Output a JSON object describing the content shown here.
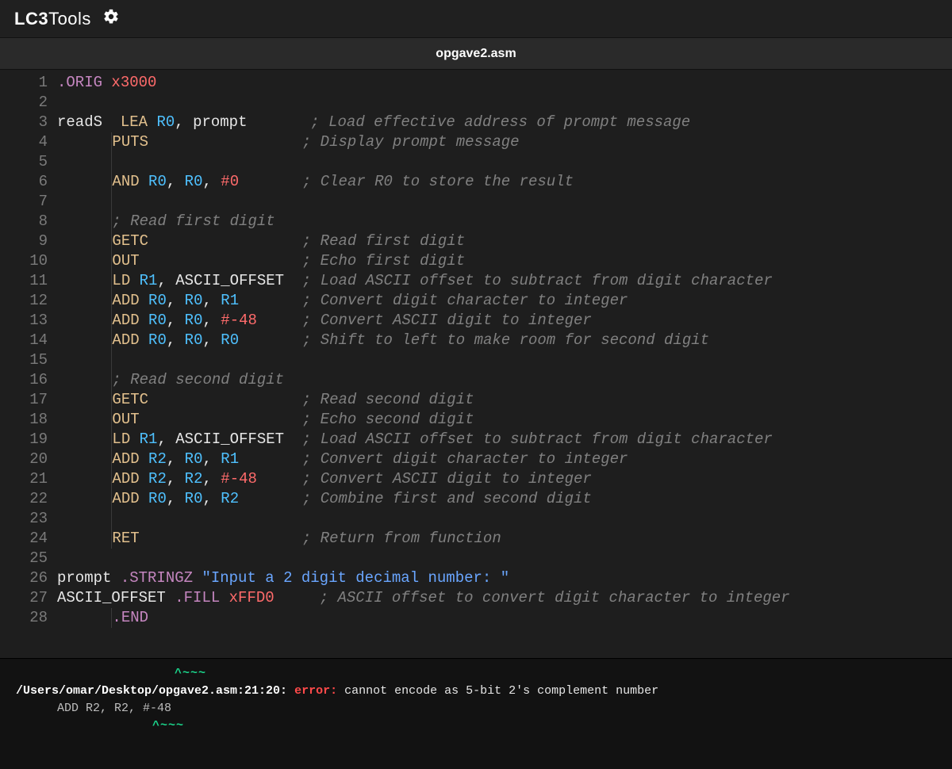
{
  "app": {
    "title_bold": "LC3",
    "title_thin": "Tools"
  },
  "tab": {
    "filename": "opgave2.asm"
  },
  "editor": {
    "lines": [
      {
        "n": 1,
        "tokens": [
          {
            "t": ".ORIG",
            "c": "tok-dir"
          },
          {
            "t": " "
          },
          {
            "t": "x3000",
            "c": "tok-num"
          }
        ]
      },
      {
        "n": 2,
        "tokens": []
      },
      {
        "n": 3,
        "tokens": [
          {
            "t": "readS",
            "c": "tok-lbl"
          },
          {
            "t": "  "
          },
          {
            "t": "LEA",
            "c": "tok-kw"
          },
          {
            "t": " "
          },
          {
            "t": "R0",
            "c": "tok-reg"
          },
          {
            "t": ", ",
            "c": "tok-punc"
          },
          {
            "t": "prompt",
            "c": "tok-lbl"
          },
          {
            "t": "       "
          },
          {
            "t": "; Load effective address of prompt message",
            "c": "tok-com"
          }
        ]
      },
      {
        "n": 4,
        "guide": true,
        "tokens": [
          {
            "t": "       "
          },
          {
            "t": "PUTS",
            "c": "tok-kw"
          },
          {
            "t": "                 "
          },
          {
            "t": "; Display prompt message",
            "c": "tok-com"
          }
        ]
      },
      {
        "n": 5,
        "guide": true,
        "tokens": []
      },
      {
        "n": 6,
        "guide": true,
        "tokens": [
          {
            "t": "       "
          },
          {
            "t": "AND",
            "c": "tok-kw"
          },
          {
            "t": " "
          },
          {
            "t": "R0",
            "c": "tok-reg"
          },
          {
            "t": ", ",
            "c": "tok-punc"
          },
          {
            "t": "R0",
            "c": "tok-reg"
          },
          {
            "t": ", ",
            "c": "tok-punc"
          },
          {
            "t": "#0",
            "c": "tok-num"
          },
          {
            "t": "       "
          },
          {
            "t": "; Clear R0 to store the result",
            "c": "tok-com"
          }
        ]
      },
      {
        "n": 7,
        "guide": true,
        "tokens": []
      },
      {
        "n": 8,
        "guide": true,
        "tokens": [
          {
            "t": "       "
          },
          {
            "t": "; Read first digit",
            "c": "tok-com"
          }
        ]
      },
      {
        "n": 9,
        "guide": true,
        "tokens": [
          {
            "t": "       "
          },
          {
            "t": "GETC",
            "c": "tok-kw"
          },
          {
            "t": "                 "
          },
          {
            "t": "; Read first digit",
            "c": "tok-com"
          }
        ]
      },
      {
        "n": 10,
        "guide": true,
        "tokens": [
          {
            "t": "       "
          },
          {
            "t": "OUT",
            "c": "tok-kw"
          },
          {
            "t": "                  "
          },
          {
            "t": "; Echo first digit",
            "c": "tok-com"
          }
        ]
      },
      {
        "n": 11,
        "guide": true,
        "tokens": [
          {
            "t": "       "
          },
          {
            "t": "LD",
            "c": "tok-kw"
          },
          {
            "t": " "
          },
          {
            "t": "R1",
            "c": "tok-reg"
          },
          {
            "t": ", ",
            "c": "tok-punc"
          },
          {
            "t": "ASCII_OFFSET",
            "c": "tok-lbl"
          },
          {
            "t": "  "
          },
          {
            "t": "; Load ASCII offset to subtract from digit character",
            "c": "tok-com"
          }
        ]
      },
      {
        "n": 12,
        "guide": true,
        "tokens": [
          {
            "t": "       "
          },
          {
            "t": "ADD",
            "c": "tok-kw"
          },
          {
            "t": " "
          },
          {
            "t": "R0",
            "c": "tok-reg"
          },
          {
            "t": ", ",
            "c": "tok-punc"
          },
          {
            "t": "R0",
            "c": "tok-reg"
          },
          {
            "t": ", ",
            "c": "tok-punc"
          },
          {
            "t": "R1",
            "c": "tok-reg"
          },
          {
            "t": "       "
          },
          {
            "t": "; Convert digit character to integer",
            "c": "tok-com"
          }
        ]
      },
      {
        "n": 13,
        "guide": true,
        "tokens": [
          {
            "t": "       "
          },
          {
            "t": "ADD",
            "c": "tok-kw"
          },
          {
            "t": " "
          },
          {
            "t": "R0",
            "c": "tok-reg"
          },
          {
            "t": ", ",
            "c": "tok-punc"
          },
          {
            "t": "R0",
            "c": "tok-reg"
          },
          {
            "t": ", ",
            "c": "tok-punc"
          },
          {
            "t": "#-48",
            "c": "tok-num"
          },
          {
            "t": "     "
          },
          {
            "t": "; Convert ASCII digit to integer",
            "c": "tok-com"
          }
        ]
      },
      {
        "n": 14,
        "guide": true,
        "tokens": [
          {
            "t": "       "
          },
          {
            "t": "ADD",
            "c": "tok-kw"
          },
          {
            "t": " "
          },
          {
            "t": "R0",
            "c": "tok-reg"
          },
          {
            "t": ", ",
            "c": "tok-punc"
          },
          {
            "t": "R0",
            "c": "tok-reg"
          },
          {
            "t": ", ",
            "c": "tok-punc"
          },
          {
            "t": "R0",
            "c": "tok-reg"
          },
          {
            "t": "       "
          },
          {
            "t": "; Shift to left to make room for second digit",
            "c": "tok-com"
          }
        ]
      },
      {
        "n": 15,
        "guide": true,
        "tokens": []
      },
      {
        "n": 16,
        "guide": true,
        "tokens": [
          {
            "t": "       "
          },
          {
            "t": "; Read second digit",
            "c": "tok-com"
          }
        ]
      },
      {
        "n": 17,
        "guide": true,
        "tokens": [
          {
            "t": "       "
          },
          {
            "t": "GETC",
            "c": "tok-kw"
          },
          {
            "t": "                 "
          },
          {
            "t": "; Read second digit",
            "c": "tok-com"
          }
        ]
      },
      {
        "n": 18,
        "guide": true,
        "tokens": [
          {
            "t": "       "
          },
          {
            "t": "OUT",
            "c": "tok-kw"
          },
          {
            "t": "                  "
          },
          {
            "t": "; Echo second digit",
            "c": "tok-com"
          }
        ]
      },
      {
        "n": 19,
        "guide": true,
        "tokens": [
          {
            "t": "       "
          },
          {
            "t": "LD",
            "c": "tok-kw"
          },
          {
            "t": " "
          },
          {
            "t": "R1",
            "c": "tok-reg"
          },
          {
            "t": ", ",
            "c": "tok-punc"
          },
          {
            "t": "ASCII_OFFSET",
            "c": "tok-lbl"
          },
          {
            "t": "  "
          },
          {
            "t": "; Load ASCII offset to subtract from digit character",
            "c": "tok-com"
          }
        ]
      },
      {
        "n": 20,
        "guide": true,
        "tokens": [
          {
            "t": "       "
          },
          {
            "t": "ADD",
            "c": "tok-kw"
          },
          {
            "t": " "
          },
          {
            "t": "R2",
            "c": "tok-reg"
          },
          {
            "t": ", ",
            "c": "tok-punc"
          },
          {
            "t": "R0",
            "c": "tok-reg"
          },
          {
            "t": ", ",
            "c": "tok-punc"
          },
          {
            "t": "R1",
            "c": "tok-reg"
          },
          {
            "t": "       "
          },
          {
            "t": "; Convert digit character to integer",
            "c": "tok-com"
          }
        ]
      },
      {
        "n": 21,
        "guide": true,
        "tokens": [
          {
            "t": "       "
          },
          {
            "t": "ADD",
            "c": "tok-kw"
          },
          {
            "t": " "
          },
          {
            "t": "R2",
            "c": "tok-reg"
          },
          {
            "t": ", ",
            "c": "tok-punc"
          },
          {
            "t": "R2",
            "c": "tok-reg"
          },
          {
            "t": ", ",
            "c": "tok-punc"
          },
          {
            "t": "#-48",
            "c": "tok-num"
          },
          {
            "t": "     "
          },
          {
            "t": "; Convert ASCII digit to integer",
            "c": "tok-com"
          }
        ]
      },
      {
        "n": 22,
        "guide": true,
        "tokens": [
          {
            "t": "       "
          },
          {
            "t": "ADD",
            "c": "tok-kw"
          },
          {
            "t": " "
          },
          {
            "t": "R0",
            "c": "tok-reg"
          },
          {
            "t": ", ",
            "c": "tok-punc"
          },
          {
            "t": "R0",
            "c": "tok-reg"
          },
          {
            "t": ", ",
            "c": "tok-punc"
          },
          {
            "t": "R2",
            "c": "tok-reg"
          },
          {
            "t": "       "
          },
          {
            "t": "; Combine first and second digit",
            "c": "tok-com"
          }
        ]
      },
      {
        "n": 23,
        "guide": true,
        "tokens": []
      },
      {
        "n": 24,
        "guide": true,
        "tokens": [
          {
            "t": "       "
          },
          {
            "t": "RET",
            "c": "tok-kw"
          },
          {
            "t": "                  "
          },
          {
            "t": "; Return from function",
            "c": "tok-com"
          }
        ]
      },
      {
        "n": 25,
        "tokens": []
      },
      {
        "n": 26,
        "tokens": [
          {
            "t": "prompt",
            "c": "tok-lbl"
          },
          {
            "t": " "
          },
          {
            "t": ".STRINGZ",
            "c": "tok-dir"
          },
          {
            "t": " "
          },
          {
            "t": "\"Input a 2 digit decimal number: \"",
            "c": "tok-str"
          }
        ]
      },
      {
        "n": 27,
        "tokens": [
          {
            "t": "ASCII_OFFSET",
            "c": "tok-lbl"
          },
          {
            "t": " "
          },
          {
            "t": ".FILL",
            "c": "tok-dir"
          },
          {
            "t": " "
          },
          {
            "t": "xFFD0",
            "c": "tok-num"
          },
          {
            "t": "     "
          },
          {
            "t": "; ASCII offset to convert digit character to integer",
            "c": "tok-com"
          }
        ]
      },
      {
        "n": 28,
        "guide": true,
        "tokens": [
          {
            "t": ".END",
            "c": "tok-dir"
          }
        ]
      }
    ]
  },
  "console": {
    "top_wave": "^~~~",
    "path": "/Users/omar/Desktop/opgave2.asm:21:20:",
    "error_label": "error:",
    "message": "cannot encode as 5-bit 2's complement number",
    "detail": "ADD R2, R2, #-48",
    "caret": "^~~~"
  }
}
